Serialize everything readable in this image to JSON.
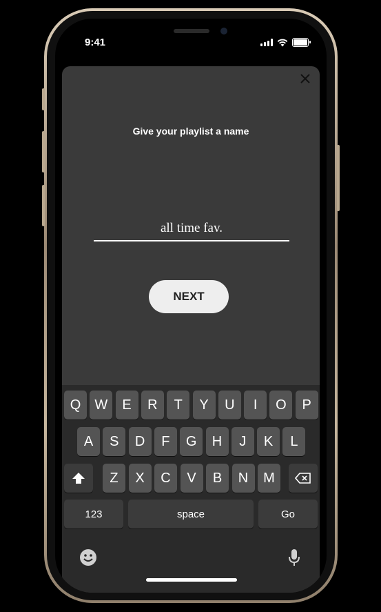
{
  "status_bar": {
    "time": "9:41"
  },
  "sheet": {
    "close_icon": "close-icon",
    "prompt": "Give your playlist a name",
    "playlist_name": {
      "value": "all time fav.",
      "placeholder": ""
    },
    "next_label": "NEXT"
  },
  "keyboard": {
    "row1": [
      "Q",
      "W",
      "E",
      "R",
      "T",
      "Y",
      "U",
      "I",
      "O",
      "P"
    ],
    "row2": [
      "A",
      "S",
      "D",
      "F",
      "G",
      "H",
      "J",
      "K",
      "L"
    ],
    "row3": [
      "Z",
      "X",
      "C",
      "V",
      "B",
      "N",
      "M"
    ],
    "numbers_label": "123",
    "space_label": "space",
    "go_label": "Go",
    "shift_icon": "shift-icon",
    "delete_icon": "backspace-icon",
    "emoji_icon": "emoji-icon",
    "mic_icon": "microphone-icon"
  },
  "colors": {
    "sheet_bg": "#3a3a3a",
    "keyboard_bg": "#2a2a2a",
    "key_bg": "#545454",
    "next_button_bg": "#eeeeee"
  }
}
